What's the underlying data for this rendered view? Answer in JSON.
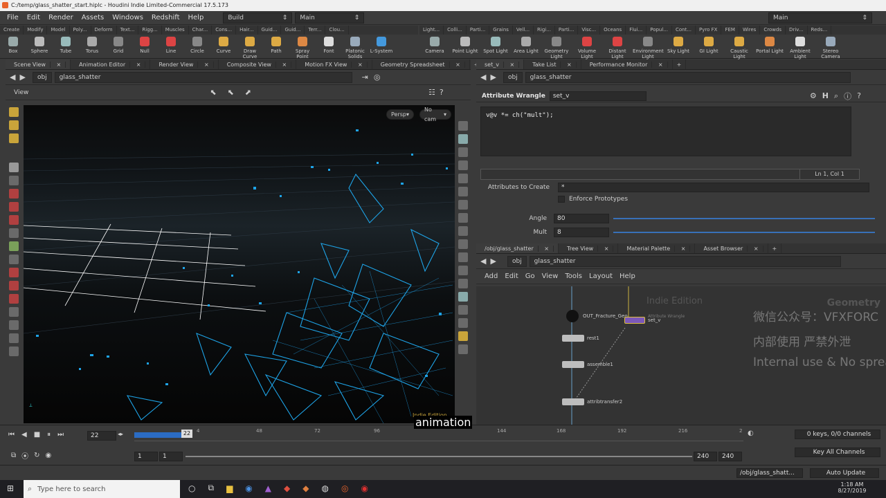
{
  "window": {
    "title": "C:/temp/glass_shatter_start.hiplc - Houdini Indie Limited-Commercial 17.5.173"
  },
  "menu": {
    "items": [
      "File",
      "Edit",
      "Render",
      "Assets",
      "Windows",
      "Redshift",
      "Help"
    ],
    "build_label": "Build",
    "desktop_label": "Main",
    "right_desktop_label": "Main"
  },
  "shelf": {
    "left_tabs": [
      "Create",
      "Modify",
      "Model",
      "Poly...",
      "Deform",
      "Text...",
      "Rigg...",
      "Muscles",
      "Char...",
      "Cons...",
      "Hair...",
      "Guid...",
      "Guid...",
      "Terr...",
      "Clou..."
    ],
    "left_tools": [
      "Box",
      "Sphere",
      "Tube",
      "Torus",
      "Grid",
      "Null",
      "Line",
      "Circle",
      "Curve",
      "Draw Curve",
      "Path",
      "Spray Point",
      "Font",
      "Platonic Solids",
      "L-System"
    ],
    "right_tabs": [
      "Light...",
      "Colli...",
      "Parti...",
      "Grains",
      "Vell...",
      "Rigi...",
      "Parti...",
      "Visc...",
      "Oceans",
      "Flui...",
      "Popul...",
      "Cont...",
      "Pyro FX",
      "FEM",
      "Wires",
      "Crowds",
      "Driv...",
      "Reds..."
    ],
    "right_tools": [
      "Camera",
      "Point Light",
      "Spot Light",
      "Area Light",
      "Geometry Light",
      "Volume Light",
      "Distant Light",
      "Environment Light",
      "Sky Light",
      "GI Light",
      "Caustic Light",
      "Portal Light",
      "Ambient Light",
      "Stereo Camera"
    ]
  },
  "left_pane": {
    "tabs": [
      "Scene View",
      "Animation Editor",
      "Render View",
      "Composite View",
      "Motion FX View",
      "Geometry Spreadsheet"
    ],
    "path_obj": "obj",
    "path_node": "glass_shatter",
    "view_label": "View",
    "persp": "Persp",
    "cam": "No cam",
    "indie": "Indie Edition"
  },
  "params": {
    "tabs": [
      "set_v",
      "Take List",
      "Performance Monitor"
    ],
    "path_obj": "obj",
    "path_node": "glass_shatter",
    "node_type": "Attribute Wrangle",
    "node_name": "set_v",
    "code": "v@v *= ch(\"mult\");",
    "cursor": "Ln 1, Col 1",
    "attr_label": "Attributes to Create",
    "attr_value": "*",
    "enforce_label": "Enforce Prototypes",
    "angle_label": "Angle",
    "angle_value": "80",
    "mult_label": "Mult",
    "mult_value": "8"
  },
  "network": {
    "tabs": [
      "/obj/glass_shatter",
      "Tree View",
      "Material Palette",
      "Asset Browser"
    ],
    "path_obj": "obj",
    "path_node": "glass_shatter",
    "menu": [
      "Add",
      "Edit",
      "Go",
      "View",
      "Tools",
      "Layout",
      "Help"
    ],
    "indie": "Indie Edition",
    "context": "Geometry",
    "nodes": [
      {
        "name": "OUT_Fracture_Geo"
      },
      {
        "name": "rest1"
      },
      {
        "name": "assemble1"
      },
      {
        "name": "attribtransfer2"
      },
      {
        "name": "set_v",
        "type": "Attribute Wrangle"
      }
    ]
  },
  "watermark": {
    "line1": "微信公众号：VFXFORC",
    "line2": "内部使用 严禁外泄",
    "line3": "Internal use & No sprea"
  },
  "timeline": {
    "frame": "22",
    "ticks": [
      "4",
      "48",
      "72",
      "96",
      "144",
      "168",
      "192",
      "216",
      "2"
    ],
    "start": "1",
    "start2": "1",
    "end": "240",
    "end2": "240",
    "keys": "0 keys, 0/0 channels",
    "key_all": "Key All Channels",
    "caption": "animation"
  },
  "status": {
    "path": "/obj/glass_shatt...",
    "update": "Auto Update"
  },
  "taskbar": {
    "search": "Type here to search",
    "time": "1:18 AM",
    "date": "8/27/2019"
  }
}
